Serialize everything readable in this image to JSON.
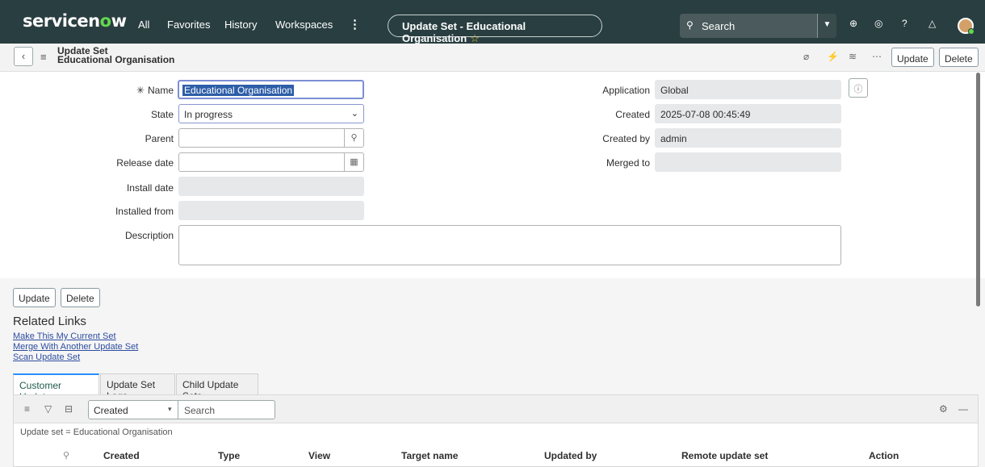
{
  "nav": {
    "logo_prefix": "servicen",
    "logo_accent": "o",
    "logo_suffix": "w",
    "links": [
      "All",
      "Favorites",
      "History",
      "Workspaces"
    ],
    "context_title": "Update Set - Educational Organisation",
    "search_placeholder": "Search",
    "accent_color": "#62d84e",
    "icons": [
      "globe-icon",
      "chat-icon",
      "help-icon",
      "bell-icon"
    ]
  },
  "formbar": {
    "title_line1": "Update Set",
    "title_line2": "Educational Organisation",
    "update_label": "Update",
    "delete_label": "Delete"
  },
  "form": {
    "name_label": "Name",
    "name_value": "Educational Organisation",
    "state_label": "State",
    "state_value": "In progress",
    "parent_label": "Parent",
    "release_date_label": "Release date",
    "install_date_label": "Install date",
    "installed_from_label": "Installed from",
    "description_label": "Description",
    "application_label": "Application",
    "application_value": "Global",
    "created_label": "Created",
    "created_value": "2025-07-08 00:45:49",
    "created_by_label": "Created by",
    "created_by_value": "admin",
    "merged_to_label": "Merged to"
  },
  "actions": {
    "update_label": "Update",
    "delete_label": "Delete"
  },
  "related_links": {
    "title": "Related Links",
    "links": [
      "Make This My Current Set",
      "Merge With Another Update Set",
      "Scan Update Set"
    ]
  },
  "tabs": [
    "Customer Updates",
    "Update Set Logs",
    "Child Update Sets"
  ],
  "list": {
    "field_value": "Created",
    "search_placeholder": "Search",
    "breadcrumb": "Update set = Educational Organisation",
    "columns": [
      "Created",
      "Type",
      "View",
      "Target name",
      "Updated by",
      "Remote update set",
      "Action"
    ]
  }
}
